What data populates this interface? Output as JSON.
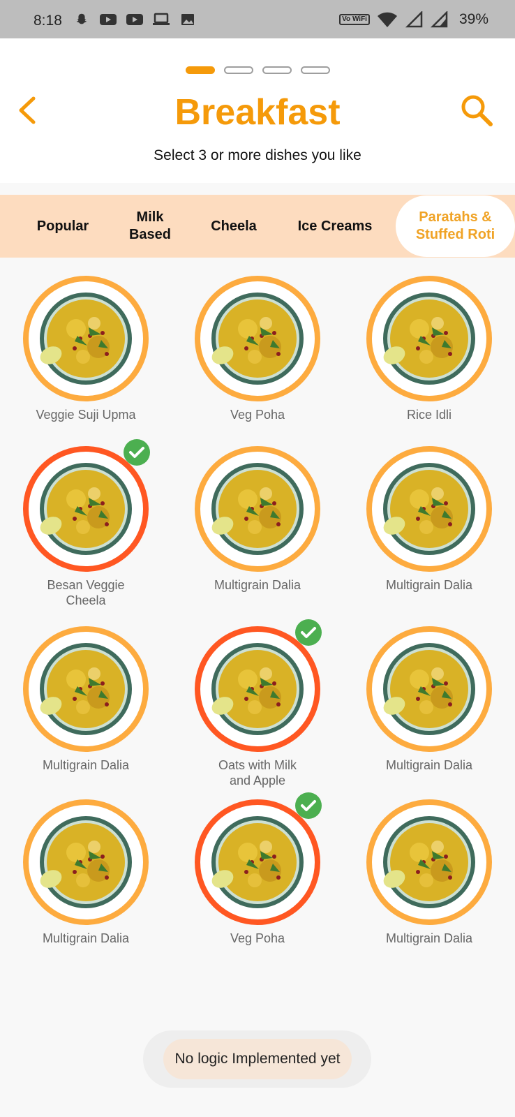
{
  "status_bar": {
    "time": "8:18",
    "wifi_badge": "Vo WiFi",
    "battery": "39%",
    "left_icons": [
      "snapchat-icon",
      "youtube-icon",
      "youtube-icon",
      "laptop-icon",
      "image-icon"
    ]
  },
  "header": {
    "title": "Breakfast",
    "subtitle": "Select 3 or more dishes you like",
    "progress_steps": 4,
    "active_step": 1
  },
  "tabs": [
    {
      "label": "Popular",
      "active": false
    },
    {
      "label": "Milk\nBased",
      "active": false
    },
    {
      "label": "Cheela",
      "active": false
    },
    {
      "label": "Ice Creams",
      "active": false
    },
    {
      "label": "Paratahs &\nStuffed Roti",
      "active": true
    }
  ],
  "dishes": [
    {
      "name": "Veggie Suji Upma",
      "selected": false
    },
    {
      "name": "Veg Poha",
      "selected": false
    },
    {
      "name": "Rice Idli",
      "selected": false
    },
    {
      "name": "Besan Veggie\nCheela",
      "selected": true
    },
    {
      "name": "Multigrain Dalia",
      "selected": false
    },
    {
      "name": "Multigrain Dalia",
      "selected": false
    },
    {
      "name": "Multigrain Dalia",
      "selected": false
    },
    {
      "name": "Oats with Milk\nand Apple",
      "selected": true
    },
    {
      "name": "Multigrain Dalia",
      "selected": false
    },
    {
      "name": "Multigrain Dalia",
      "selected": false
    },
    {
      "name": "Veg Poha",
      "selected": true
    },
    {
      "name": "Multigrain Dalia",
      "selected": false
    }
  ],
  "toast": {
    "message": "No logic Implemented yet"
  },
  "colors": {
    "accent": "#f59a0a",
    "ring": "#fdab3f",
    "ring_selected": "#ff5722",
    "check": "#4caf50",
    "tab_bar": "#fddcbf"
  }
}
